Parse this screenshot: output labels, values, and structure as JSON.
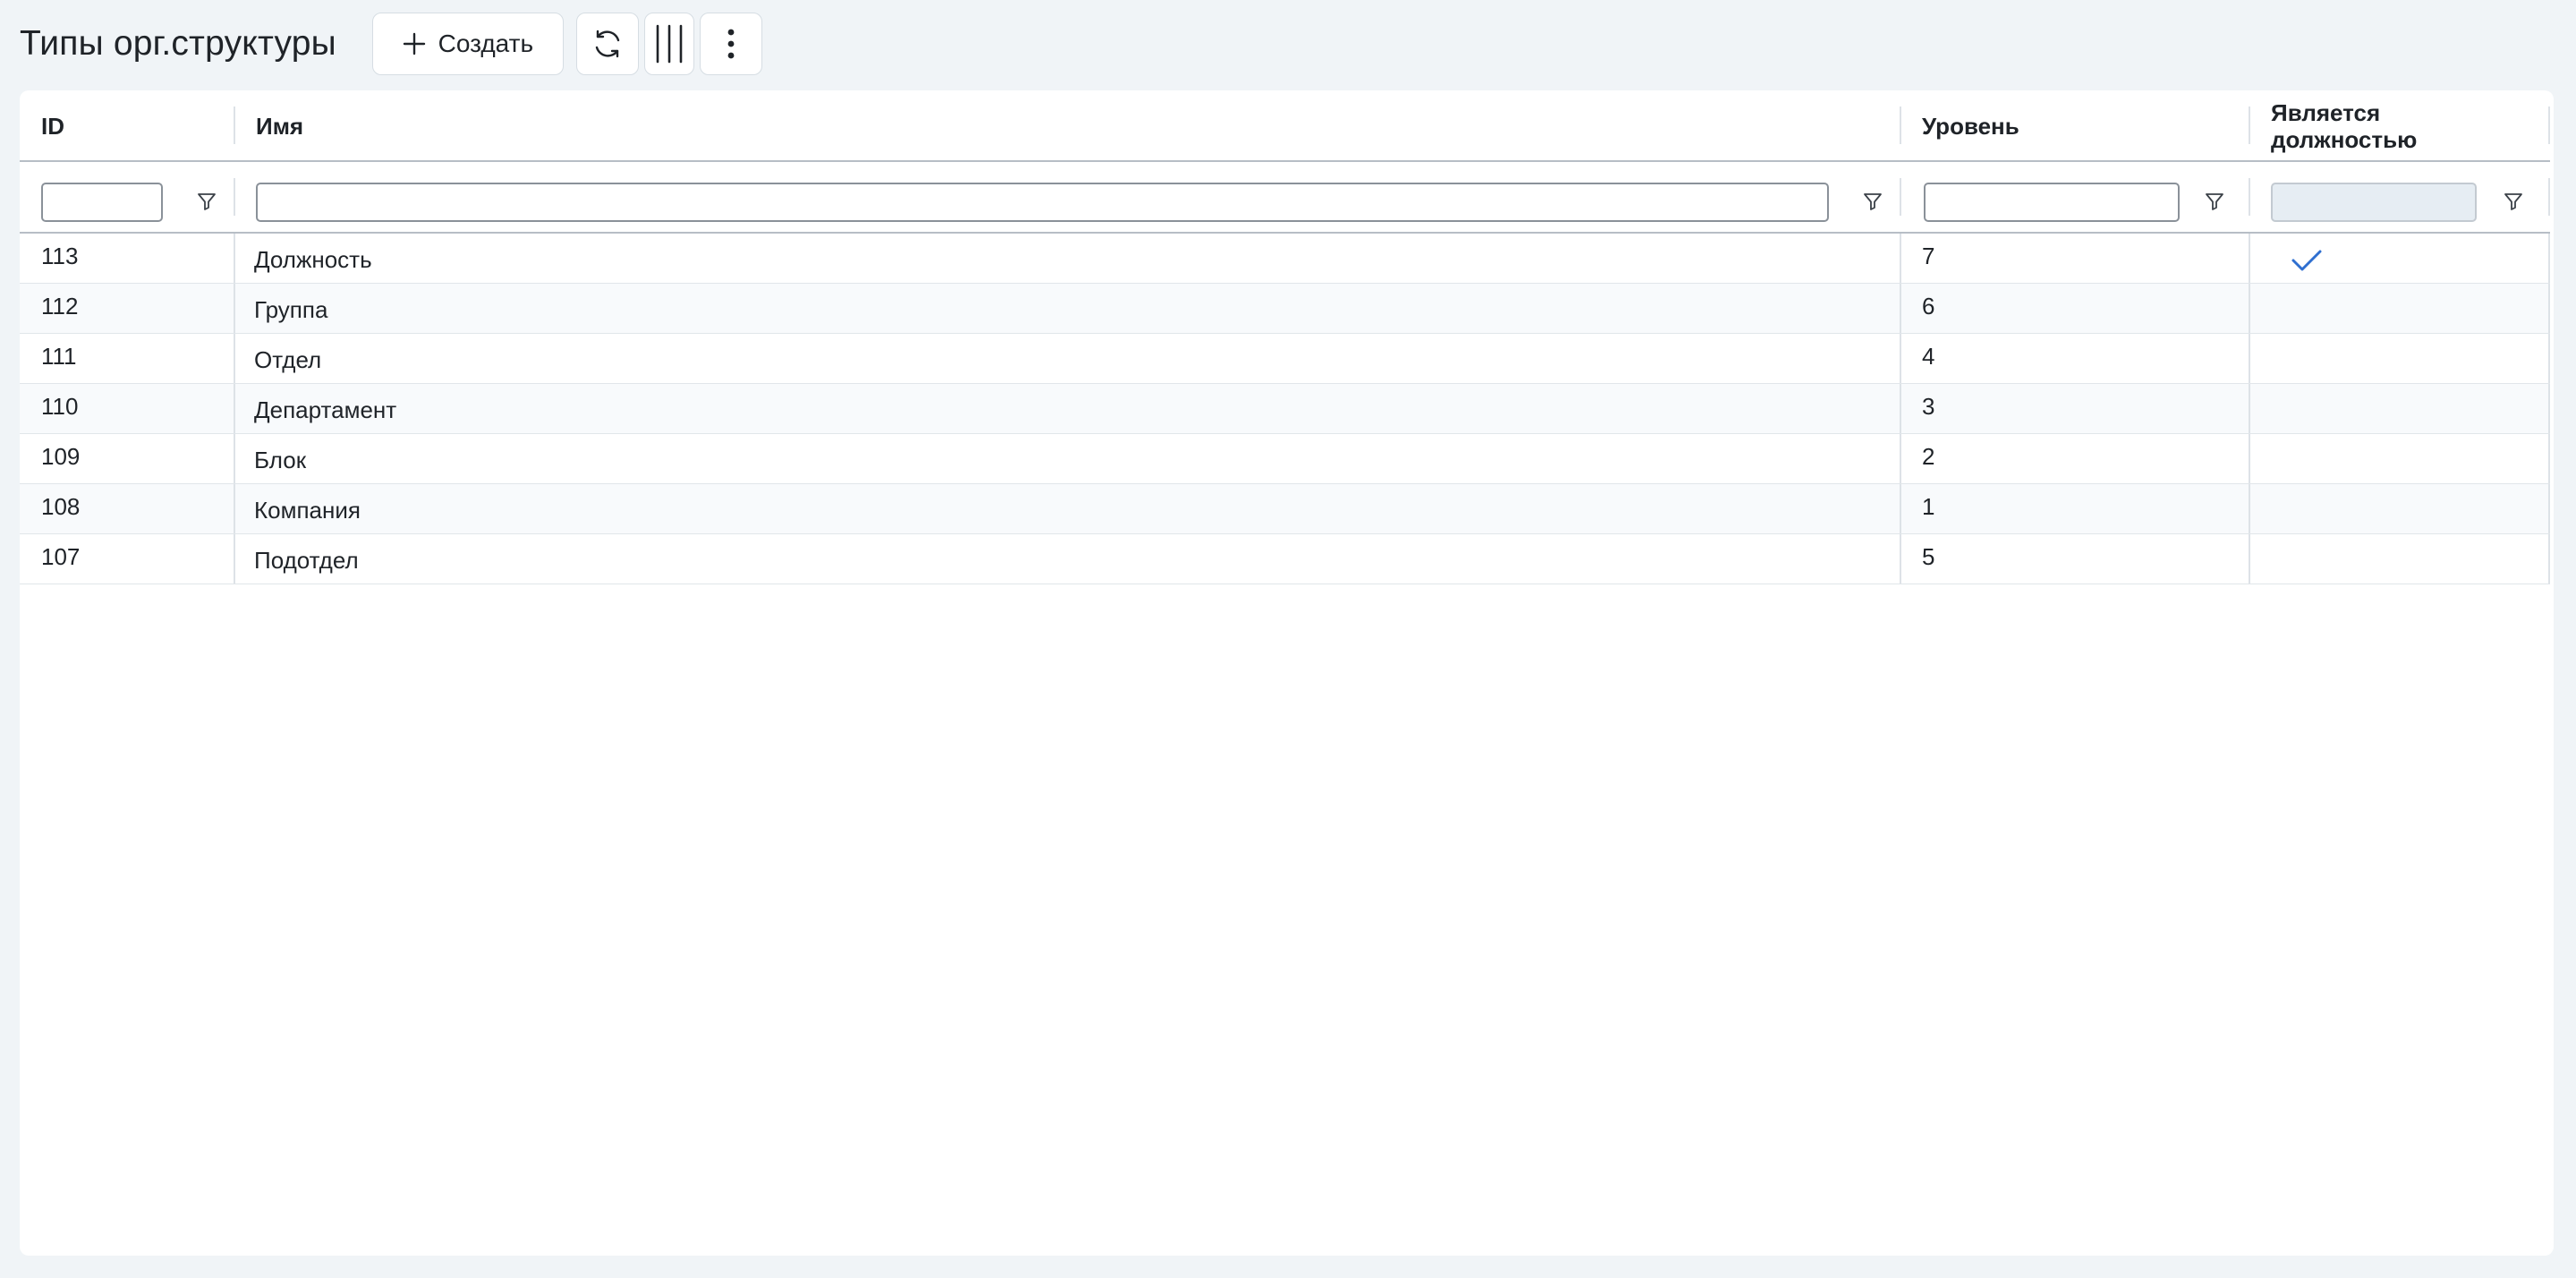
{
  "page": {
    "title": "Типы орг.структуры"
  },
  "toolbar": {
    "create_label": "Создать",
    "buttons": [
      "plus-icon",
      "refresh-icon",
      "columns-icon",
      "more-vertical-icon"
    ]
  },
  "table": {
    "columns": [
      {
        "key": "id",
        "label": "ID"
      },
      {
        "key": "name",
        "label": "Имя"
      },
      {
        "key": "level",
        "label": "Уровень"
      },
      {
        "key": "is_position",
        "label_line1": "Является",
        "label_line2": "должностью"
      }
    ],
    "filters": {
      "id": "",
      "name": "",
      "level": "",
      "is_position": ""
    },
    "rows": [
      {
        "id": "113",
        "name": "Должность",
        "level": "7",
        "is_position": true
      },
      {
        "id": "112",
        "name": "Группа",
        "level": "6",
        "is_position": false
      },
      {
        "id": "111",
        "name": "Отдел",
        "level": "4",
        "is_position": false
      },
      {
        "id": "110",
        "name": "Департамент",
        "level": "3",
        "is_position": false
      },
      {
        "id": "109",
        "name": "Блок",
        "level": "2",
        "is_position": false
      },
      {
        "id": "108",
        "name": "Компания",
        "level": "1",
        "is_position": false
      },
      {
        "id": "107",
        "name": "Подотдел",
        "level": "5",
        "is_position": false
      }
    ]
  },
  "colors": {
    "background": "#f0f4f7",
    "panel": "#ffffff",
    "check": "#2f6fd0",
    "border": "#dde2e7"
  }
}
